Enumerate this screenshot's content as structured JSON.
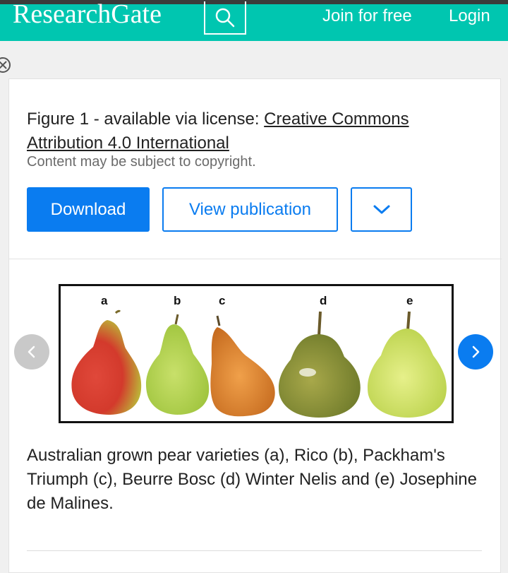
{
  "header": {
    "logo": "ResearchGate",
    "join_label": "Join for free",
    "login_label": "Login",
    "search_icon": "search-icon",
    "bg_color": "#00c6b0"
  },
  "figure_card": {
    "title_prefix": "Figure 1 - available via license: ",
    "license_link": "Creative Commons Attribution 4.0 International",
    "copyright_note": "Content may be subject to copyright.",
    "download_label": "Download",
    "view_publication_label": "View publication",
    "more_icon": "chevron-down-icon",
    "accent_color": "#0a7cf0"
  },
  "figure": {
    "panel_labels": [
      "a",
      "b",
      "c",
      "d",
      "e"
    ],
    "caption": "Australian grown pear varieties (a), Rico (b), Packham's Triumph (c), Beurre Bosc (d) Winter Nelis and (e) Josephine de Malines."
  },
  "carousel": {
    "prev_icon": "chevron-left-icon",
    "next_icon": "chevron-right-icon"
  }
}
